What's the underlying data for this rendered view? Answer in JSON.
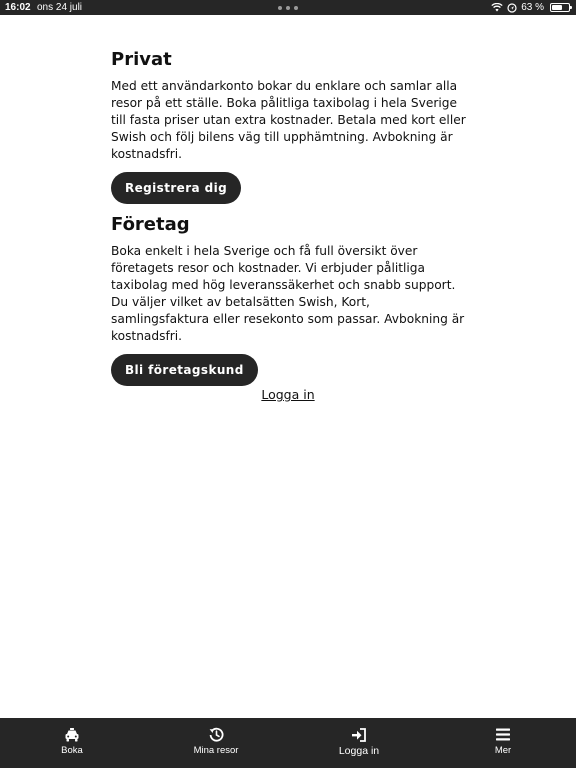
{
  "status_bar": {
    "time": "16:02",
    "date": "ons 24 juli",
    "battery": "63 %",
    "battery_level": 0.63
  },
  "privat": {
    "title": "Privat",
    "text": "Med ett användarkonto bokar du enklare och samlar alla resor på ett ställe. Boka pålitliga taxibolag i hela Sverige till fasta priser utan extra kostnader. Betala med kort eller Swish och följ bilens väg till upphämtning. Avbokning är kostnadsfri.",
    "button_label": "Registrera dig"
  },
  "foretag": {
    "title": "Företag",
    "text": "Boka enkelt i hela Sverige och få full översikt över företagets resor och kostnader. Vi erbjuder pålitliga taxibolag med hög leveranssäkerhet och snabb support. Du väljer vilket av betalsätten Swish, Kort, samlingsfaktura eller resekonto som passar. Avbokning är kostnadsfri.",
    "button_label": "Bli företagskund"
  },
  "login_link": "Logga in",
  "tab_bar": {
    "items": [
      {
        "label": "Boka",
        "icon": "taxi-car-icon"
      },
      {
        "label": "Mina resor",
        "icon": "history-icon"
      },
      {
        "label": "Logga in",
        "icon": "login-icon"
      },
      {
        "label": "Mer",
        "icon": "menu-icon"
      }
    ]
  },
  "colors": {
    "dark": "#262626",
    "background": "#ffffff",
    "text": "#111111"
  }
}
